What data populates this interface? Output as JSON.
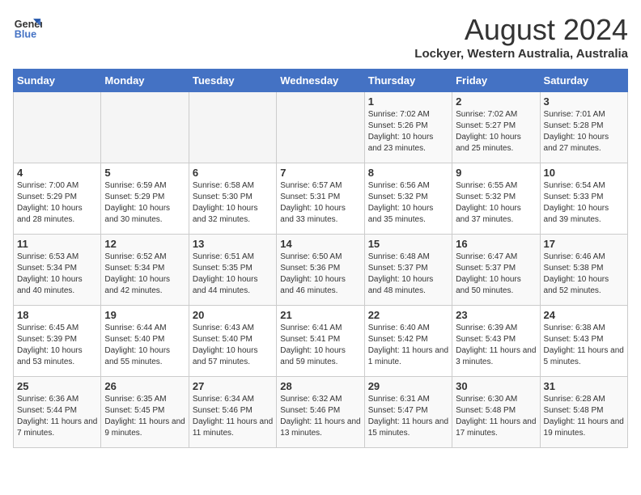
{
  "logo": {
    "line1": "General",
    "line2": "Blue"
  },
  "title": "August 2024",
  "location": "Lockyer, Western Australia, Australia",
  "weekdays": [
    "Sunday",
    "Monday",
    "Tuesday",
    "Wednesday",
    "Thursday",
    "Friday",
    "Saturday"
  ],
  "weeks": [
    [
      {
        "day": "",
        "sunrise": "",
        "sunset": "",
        "daylight": ""
      },
      {
        "day": "",
        "sunrise": "",
        "sunset": "",
        "daylight": ""
      },
      {
        "day": "",
        "sunrise": "",
        "sunset": "",
        "daylight": ""
      },
      {
        "day": "",
        "sunrise": "",
        "sunset": "",
        "daylight": ""
      },
      {
        "day": "1",
        "sunrise": "Sunrise: 7:02 AM",
        "sunset": "Sunset: 5:26 PM",
        "daylight": "Daylight: 10 hours and 23 minutes."
      },
      {
        "day": "2",
        "sunrise": "Sunrise: 7:02 AM",
        "sunset": "Sunset: 5:27 PM",
        "daylight": "Daylight: 10 hours and 25 minutes."
      },
      {
        "day": "3",
        "sunrise": "Sunrise: 7:01 AM",
        "sunset": "Sunset: 5:28 PM",
        "daylight": "Daylight: 10 hours and 27 minutes."
      }
    ],
    [
      {
        "day": "4",
        "sunrise": "Sunrise: 7:00 AM",
        "sunset": "Sunset: 5:29 PM",
        "daylight": "Daylight: 10 hours and 28 minutes."
      },
      {
        "day": "5",
        "sunrise": "Sunrise: 6:59 AM",
        "sunset": "Sunset: 5:29 PM",
        "daylight": "Daylight: 10 hours and 30 minutes."
      },
      {
        "day": "6",
        "sunrise": "Sunrise: 6:58 AM",
        "sunset": "Sunset: 5:30 PM",
        "daylight": "Daylight: 10 hours and 32 minutes."
      },
      {
        "day": "7",
        "sunrise": "Sunrise: 6:57 AM",
        "sunset": "Sunset: 5:31 PM",
        "daylight": "Daylight: 10 hours and 33 minutes."
      },
      {
        "day": "8",
        "sunrise": "Sunrise: 6:56 AM",
        "sunset": "Sunset: 5:32 PM",
        "daylight": "Daylight: 10 hours and 35 minutes."
      },
      {
        "day": "9",
        "sunrise": "Sunrise: 6:55 AM",
        "sunset": "Sunset: 5:32 PM",
        "daylight": "Daylight: 10 hours and 37 minutes."
      },
      {
        "day": "10",
        "sunrise": "Sunrise: 6:54 AM",
        "sunset": "Sunset: 5:33 PM",
        "daylight": "Daylight: 10 hours and 39 minutes."
      }
    ],
    [
      {
        "day": "11",
        "sunrise": "Sunrise: 6:53 AM",
        "sunset": "Sunset: 5:34 PM",
        "daylight": "Daylight: 10 hours and 40 minutes."
      },
      {
        "day": "12",
        "sunrise": "Sunrise: 6:52 AM",
        "sunset": "Sunset: 5:34 PM",
        "daylight": "Daylight: 10 hours and 42 minutes."
      },
      {
        "day": "13",
        "sunrise": "Sunrise: 6:51 AM",
        "sunset": "Sunset: 5:35 PM",
        "daylight": "Daylight: 10 hours and 44 minutes."
      },
      {
        "day": "14",
        "sunrise": "Sunrise: 6:50 AM",
        "sunset": "Sunset: 5:36 PM",
        "daylight": "Daylight: 10 hours and 46 minutes."
      },
      {
        "day": "15",
        "sunrise": "Sunrise: 6:48 AM",
        "sunset": "Sunset: 5:37 PM",
        "daylight": "Daylight: 10 hours and 48 minutes."
      },
      {
        "day": "16",
        "sunrise": "Sunrise: 6:47 AM",
        "sunset": "Sunset: 5:37 PM",
        "daylight": "Daylight: 10 hours and 50 minutes."
      },
      {
        "day": "17",
        "sunrise": "Sunrise: 6:46 AM",
        "sunset": "Sunset: 5:38 PM",
        "daylight": "Daylight: 10 hours and 52 minutes."
      }
    ],
    [
      {
        "day": "18",
        "sunrise": "Sunrise: 6:45 AM",
        "sunset": "Sunset: 5:39 PM",
        "daylight": "Daylight: 10 hours and 53 minutes."
      },
      {
        "day": "19",
        "sunrise": "Sunrise: 6:44 AM",
        "sunset": "Sunset: 5:40 PM",
        "daylight": "Daylight: 10 hours and 55 minutes."
      },
      {
        "day": "20",
        "sunrise": "Sunrise: 6:43 AM",
        "sunset": "Sunset: 5:40 PM",
        "daylight": "Daylight: 10 hours and 57 minutes."
      },
      {
        "day": "21",
        "sunrise": "Sunrise: 6:41 AM",
        "sunset": "Sunset: 5:41 PM",
        "daylight": "Daylight: 10 hours and 59 minutes."
      },
      {
        "day": "22",
        "sunrise": "Sunrise: 6:40 AM",
        "sunset": "Sunset: 5:42 PM",
        "daylight": "Daylight: 11 hours and 1 minute."
      },
      {
        "day": "23",
        "sunrise": "Sunrise: 6:39 AM",
        "sunset": "Sunset: 5:43 PM",
        "daylight": "Daylight: 11 hours and 3 minutes."
      },
      {
        "day": "24",
        "sunrise": "Sunrise: 6:38 AM",
        "sunset": "Sunset: 5:43 PM",
        "daylight": "Daylight: 11 hours and 5 minutes."
      }
    ],
    [
      {
        "day": "25",
        "sunrise": "Sunrise: 6:36 AM",
        "sunset": "Sunset: 5:44 PM",
        "daylight": "Daylight: 11 hours and 7 minutes."
      },
      {
        "day": "26",
        "sunrise": "Sunrise: 6:35 AM",
        "sunset": "Sunset: 5:45 PM",
        "daylight": "Daylight: 11 hours and 9 minutes."
      },
      {
        "day": "27",
        "sunrise": "Sunrise: 6:34 AM",
        "sunset": "Sunset: 5:46 PM",
        "daylight": "Daylight: 11 hours and 11 minutes."
      },
      {
        "day": "28",
        "sunrise": "Sunrise: 6:32 AM",
        "sunset": "Sunset: 5:46 PM",
        "daylight": "Daylight: 11 hours and 13 minutes."
      },
      {
        "day": "29",
        "sunrise": "Sunrise: 6:31 AM",
        "sunset": "Sunset: 5:47 PM",
        "daylight": "Daylight: 11 hours and 15 minutes."
      },
      {
        "day": "30",
        "sunrise": "Sunrise: 6:30 AM",
        "sunset": "Sunset: 5:48 PM",
        "daylight": "Daylight: 11 hours and 17 minutes."
      },
      {
        "day": "31",
        "sunrise": "Sunrise: 6:28 AM",
        "sunset": "Sunset: 5:48 PM",
        "daylight": "Daylight: 11 hours and 19 minutes."
      }
    ]
  ]
}
